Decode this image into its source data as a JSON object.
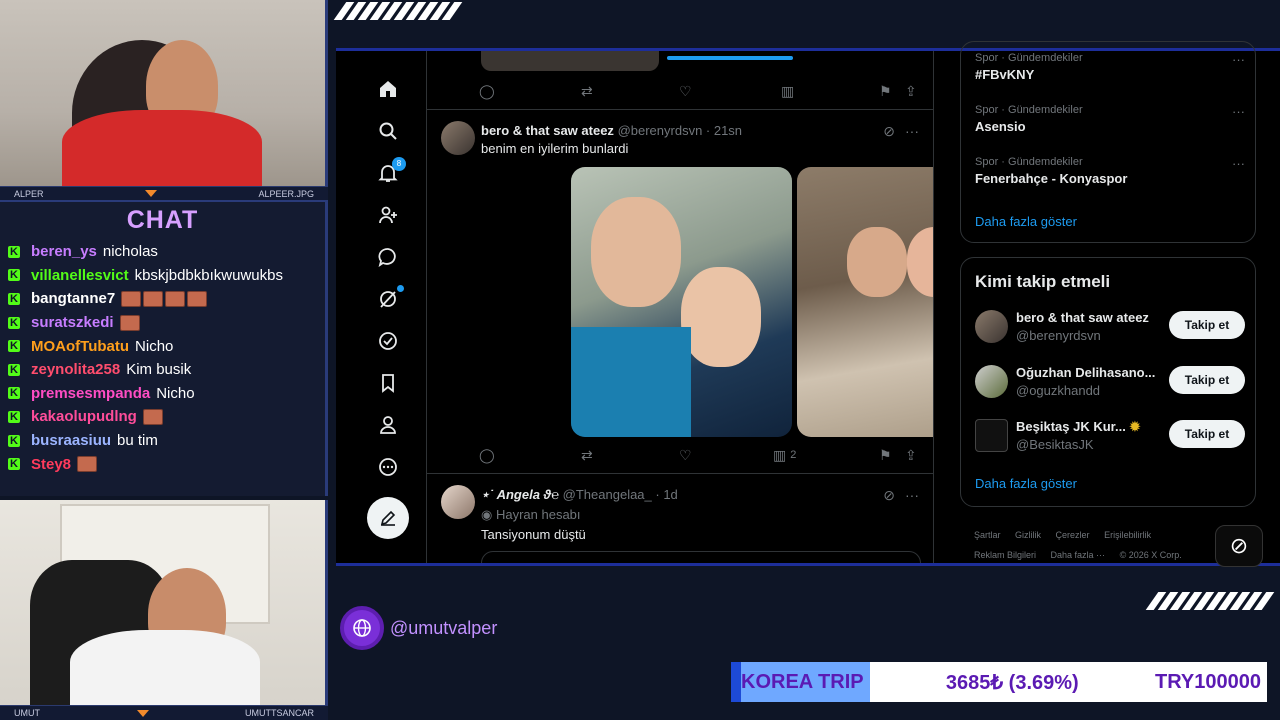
{
  "cams": {
    "top": {
      "left_label": "ALPER",
      "right_label": "ALPEER.JPG"
    },
    "bottom": {
      "left_label": "UMUT",
      "right_label": "UMUTTSANCAR"
    }
  },
  "chat": {
    "title": "CHAT",
    "messages": [
      {
        "user": "beren_ys",
        "color": "#c77dff",
        "text": "nicholas",
        "emotes": 0
      },
      {
        "user": "villanellesvict",
        "color": "#53fc18",
        "text": "kbskjbdbkbıkwuwukbs",
        "emotes": 0
      },
      {
        "user": "bangtanne7",
        "color": "#ffffff",
        "text": "",
        "emotes": 4
      },
      {
        "user": "suratszkedi",
        "color": "#c77dff",
        "text": "",
        "emotes": 1
      },
      {
        "user": "MOAofTubatu",
        "color": "#ff9f1c",
        "text": "Nicho",
        "emotes": 0
      },
      {
        "user": "zeynolita258",
        "color": "#ff4d6d",
        "text": "Kim busik",
        "emotes": 0
      },
      {
        "user": "premsesmpanda",
        "color": "#ff4dc4",
        "text": "Nicho",
        "emotes": 0
      },
      {
        "user": "kakaolupudlng",
        "color": "#ff4d9a",
        "text": "",
        "emotes": 1
      },
      {
        "user": "busraasiuu",
        "color": "#9bb4ff",
        "text": "bu tim",
        "emotes": 0
      },
      {
        "user": "Stey8",
        "color": "#ff3b5c",
        "text": "",
        "emotes": 1
      }
    ]
  },
  "x": {
    "nav": {
      "notif_count": "8"
    },
    "tweet1": {
      "name": "bero & that saw ateez",
      "handle": "@berenyrdsvn · 21sn",
      "text": "benim en iyilerim bunlardi",
      "views": "2"
    },
    "tweet2": {
      "name": "⋆˙ Angela ϑ℮",
      "handle": "@Theangelaa_ · 1d",
      "badge": "Hayran hesabı",
      "text": "Tansiyonum düştü"
    },
    "trends": [
      {
        "category": "Spor · Gündemdekiler",
        "title": "#FBvKNY"
      },
      {
        "category": "Spor · Gündemdekiler",
        "title": "Asensio"
      },
      {
        "category": "Spor · Gündemdekiler",
        "title": "Fenerbahçe - Konyaspor"
      }
    ],
    "show_more": "Daha fazla göster",
    "who_to_follow": {
      "title": "Kimi takip etmeli",
      "users": [
        {
          "name": "bero & that saw ateez",
          "handle": "@berenyrdsvn",
          "button": "Takip et"
        },
        {
          "name": "Oğuzhan Delihasano...",
          "handle": "@oguzkhandd",
          "button": "Takip et"
        },
        {
          "name": "Beşiktaş JK Kur...",
          "handle": "@BesiktasJK",
          "button": "Takip et"
        }
      ],
      "show_more": "Daha fazla göster"
    },
    "footer": [
      "Şartlar",
      "Gizlilik",
      "Çerezler",
      "Erişilebilirlik",
      "Reklam Bilgileri",
      "Daha fazla ···",
      "© 2026 X Corp."
    ]
  },
  "handle_badge": "@umutvalper",
  "ticker": {
    "title": "KOREA TRIP",
    "amount": "3685₺ (3.69%)",
    "goal": "TRY100000"
  }
}
